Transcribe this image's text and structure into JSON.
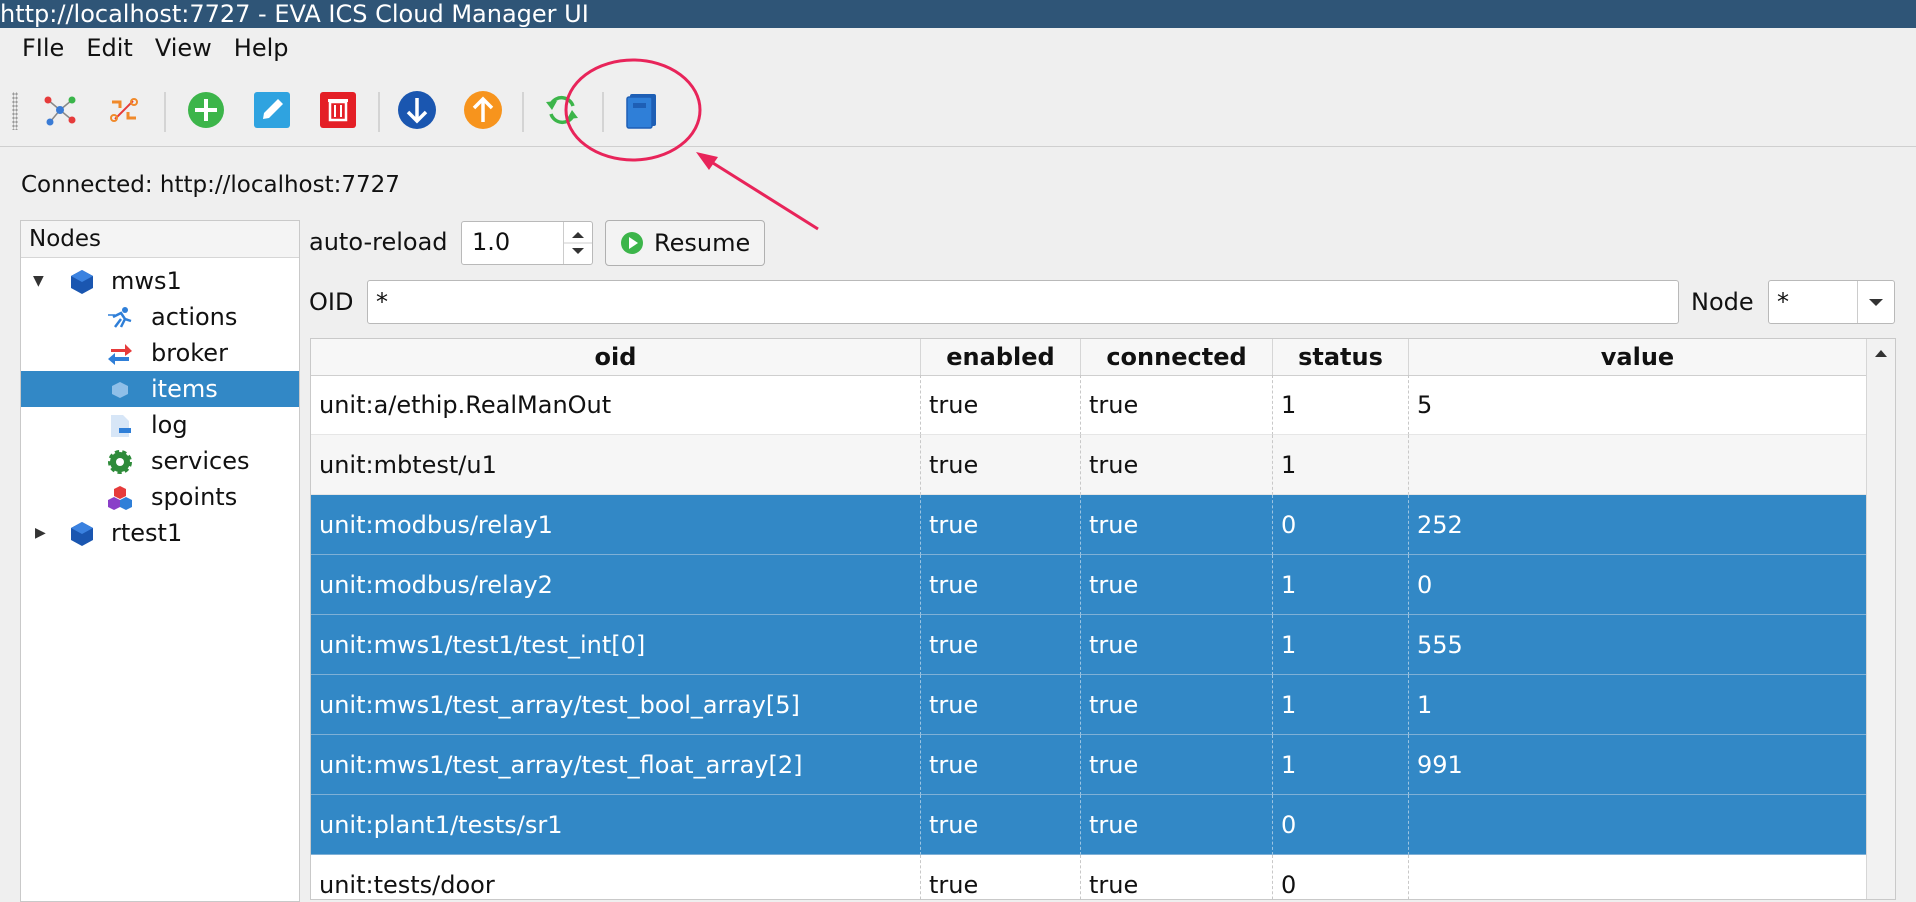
{
  "window": {
    "title": "http://localhost:7727 - EVA ICS Cloud Manager UI"
  },
  "menu": [
    "FIle",
    "Edit",
    "View",
    "Help"
  ],
  "status": {
    "connected": "Connected: http://localhost:7727"
  },
  "tree": {
    "header": "Nodes",
    "nodes": [
      {
        "label": "mws1",
        "children": [
          "actions",
          "broker",
          "items",
          "log",
          "services",
          "spoints"
        ]
      },
      {
        "label": "rtest1"
      }
    ],
    "selected": "items"
  },
  "controls": {
    "autoreload_label": "auto-reload",
    "autoreload_value": "1.0",
    "resume_label": "Resume",
    "oid_label": "OID",
    "oid_value": "*",
    "node_label": "Node",
    "node_value": "*"
  },
  "table": {
    "columns": [
      "oid",
      "enabled",
      "connected",
      "status",
      "value"
    ],
    "rows": [
      {
        "oid": "unit:a/ethip.RealManOut",
        "enabled": "true",
        "connected": "true",
        "status": "1",
        "value": "5"
      },
      {
        "oid": "unit:mbtest/u1",
        "enabled": "true",
        "connected": "true",
        "status": "1",
        "value": ""
      },
      {
        "oid": "unit:modbus/relay1",
        "enabled": "true",
        "connected": "true",
        "status": "0",
        "value": "252"
      },
      {
        "oid": "unit:modbus/relay2",
        "enabled": "true",
        "connected": "true",
        "status": "1",
        "value": "0"
      },
      {
        "oid": "unit:mws1/test1/test_int[0]",
        "enabled": "true",
        "connected": "true",
        "status": "1",
        "value": "555"
      },
      {
        "oid": "unit:mws1/test_array/test_bool_array[5]",
        "enabled": "true",
        "connected": "true",
        "status": "1",
        "value": "1"
      },
      {
        "oid": "unit:mws1/test_array/test_float_array[2]",
        "enabled": "true",
        "connected": "true",
        "status": "1",
        "value": "991"
      },
      {
        "oid": "unit:plant1/tests/sr1",
        "enabled": "true",
        "connected": "true",
        "status": "0",
        "value": ""
      },
      {
        "oid": "unit:tests/door",
        "enabled": "true",
        "connected": "true",
        "status": "0",
        "value": ""
      }
    ],
    "selected_rows": [
      2,
      3,
      4,
      5,
      6,
      7
    ]
  },
  "toolbar": {
    "icons": [
      "nodes-icon",
      "disconnect-icon",
      "add-icon",
      "edit-icon",
      "delete-icon",
      "download-icon",
      "upload-icon",
      "reload-icon",
      "book-icon"
    ]
  },
  "colors": {
    "selection": "#3288c6",
    "titlebar": "#2f5577",
    "annotation": "#e8245a"
  }
}
